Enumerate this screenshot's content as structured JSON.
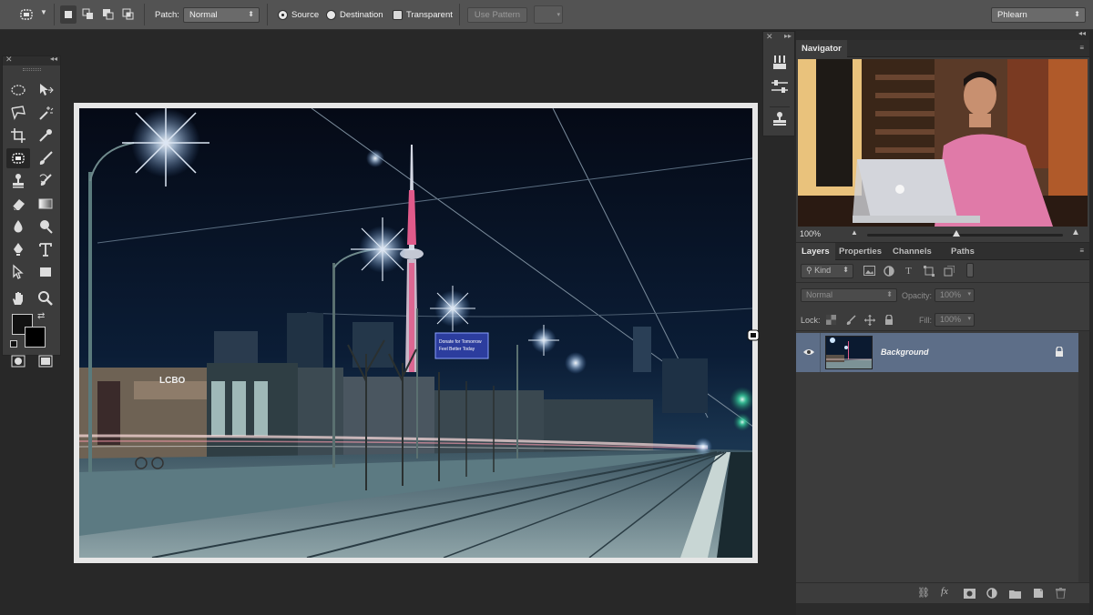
{
  "options_bar": {
    "patch_label": "Patch:",
    "patch_mode": "Normal",
    "source_label": "Source",
    "destination_label": "Destination",
    "transparent_label": "Transparent",
    "use_pattern_label": "Use Pattern",
    "workspace": "Phlearn"
  },
  "navigator": {
    "tab": "Navigator",
    "zoom": "100%"
  },
  "layers": {
    "tabs": [
      "Layers",
      "Properties",
      "Channels",
      "Paths"
    ],
    "filter_kind": "Kind",
    "blend_mode": "Normal",
    "opacity_label": "Opacity:",
    "opacity_value": "100%",
    "lock_label": "Lock:",
    "fill_label": "Fill:",
    "fill_value": "100%",
    "items": [
      {
        "name": "Background"
      }
    ]
  },
  "canvas": {
    "sign_lcbo": "LCBO",
    "billboard_line1": "Donate for Tomorrow",
    "billboard_line2": "Feel Better Today"
  },
  "colors": {
    "app_bg": "#282828",
    "panel_bg": "#3c3c3c",
    "options_bg": "#535353",
    "layer_selected": "#5d6e88"
  }
}
